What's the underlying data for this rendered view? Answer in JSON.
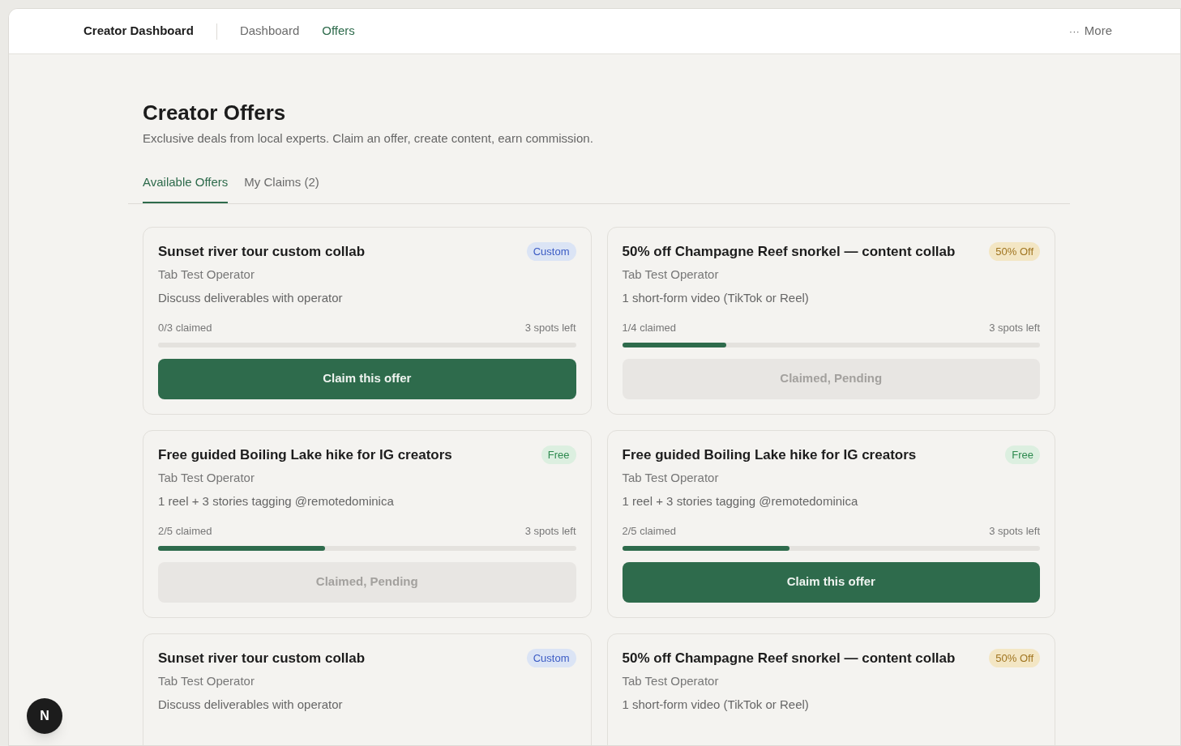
{
  "header": {
    "title": "Creator Dashboard",
    "nav": [
      {
        "label": "Dashboard",
        "selected": false
      },
      {
        "label": "Offers",
        "selected": true
      }
    ],
    "more": {
      "icon": "···",
      "label": "More"
    }
  },
  "page": {
    "title": "Creator Offers",
    "subtitle": "Exclusive deals from local experts. Claim an offer, create content, earn commission."
  },
  "tabs": [
    {
      "label": "Available Offers",
      "selected": true
    },
    {
      "label": "My Claims (2)",
      "selected": false
    }
  ],
  "offers": [
    {
      "title": "Sunset river tour custom collab",
      "badge": {
        "kind": "custom",
        "label": "Custom"
      },
      "operator": "Tab Test Operator",
      "deliverable": "Discuss deliverables with operator",
      "claimed_text": "0/3 claimed",
      "spots_left": "3 spots left",
      "level": 0,
      "claimed": false,
      "button": "Claim this offer"
    },
    {
      "title": "50% off Champagne Reef snorkel — content collab",
      "badge": {
        "kind": "discount",
        "label": "50% Off"
      },
      "operator": "Tab Test Operator",
      "deliverable": "1 short-form video (TikTok or Reel)",
      "claimed_text": "1/4 claimed",
      "spots_left": "3 spots left",
      "level": 0.25,
      "claimed": true,
      "button": "Claimed, Pending"
    },
    {
      "title": "Free guided Boiling Lake hike for IG creators",
      "badge": {
        "kind": "free",
        "label": "Free"
      },
      "operator": "Tab Test Operator",
      "deliverable": "1 reel + 3 stories tagging @remotedominica",
      "claimed_text": "2/5 claimed",
      "spots_left": "3 spots left",
      "level": 0.4,
      "claimed": true,
      "button": "Claimed, Pending"
    },
    {
      "title": "Free guided Boiling Lake hike for IG creators",
      "badge": {
        "kind": "free",
        "label": "Free"
      },
      "operator": "Tab Test Operator",
      "deliverable": "1 reel + 3 stories tagging @remotedominica",
      "claimed_text": "2/5 claimed",
      "spots_left": "3 spots left",
      "level": 0.4,
      "claimed": false,
      "button": "Claim this offer"
    },
    {
      "title": "Sunset river tour custom collab",
      "badge": {
        "kind": "custom",
        "label": "Custom"
      },
      "operator": "Tab Test Operator",
      "deliverable": "Discuss deliverables with operator"
    },
    {
      "title": "50% off Champagne Reef snorkel — content collab",
      "badge": {
        "kind": "discount",
        "label": "50% Off"
      },
      "operator": "Tab Test Operator",
      "deliverable": "1 short-form video (TikTok or Reel)"
    }
  ],
  "floating_button": {
    "label": "N"
  }
}
